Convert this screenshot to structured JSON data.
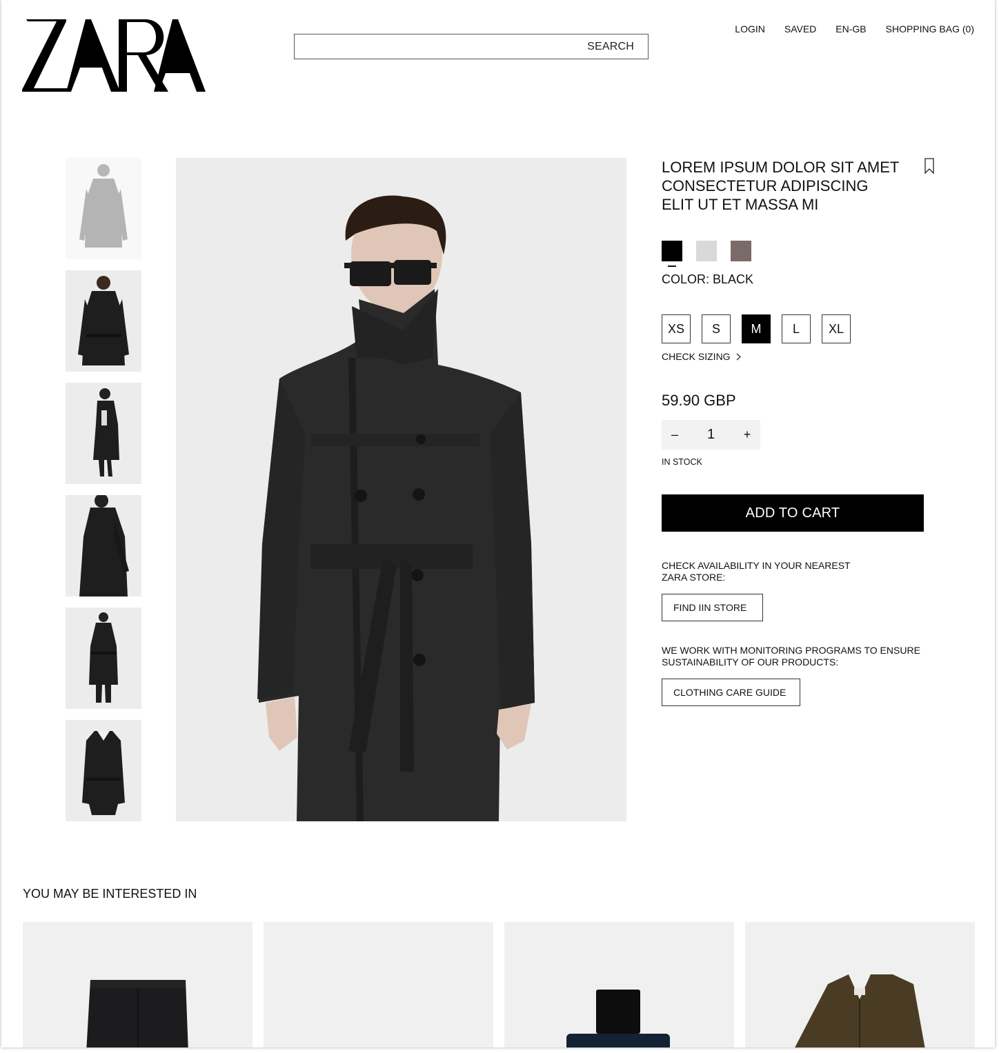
{
  "brand": {
    "logo_text": "ZARA"
  },
  "header": {
    "search_label": "SEARCH",
    "nav": [
      "LOGIN",
      "SAVED",
      "EN-GB",
      "SHOPPING BAG (0)"
    ]
  },
  "product": {
    "title_lines": [
      "LOREM IPSUM DOLOR SIT AMET",
      "CONSECTETUR ADIPISCING",
      "ELIT UT ET MASSA MI"
    ],
    "colors": [
      {
        "name": "black",
        "hex": "#000000",
        "selected": true
      },
      {
        "name": "light-grey",
        "hex": "#d9d9d9",
        "selected": false
      },
      {
        "name": "taupe",
        "hex": "#7a6b69",
        "selected": false
      }
    ],
    "color_label": "COLOR: BLACK",
    "sizes": [
      "XS",
      "S",
      "M",
      "L",
      "XL"
    ],
    "selected_size": "M",
    "check_sizing": "CHECK SIZING",
    "price": "59.90 GBP",
    "quantity": "1",
    "minus": "–",
    "plus": "+",
    "stock": "IN STOCK",
    "add_to_cart": "ADD TO CART",
    "availability_text": "CHECK AVAILABILITY IN YOUR NEAREST ZARA STORE:",
    "find_store": "FIND IIN STORE",
    "sustainability_text": "WE WORK WITH MONITORING PROGRAMS TO ENSURE SUSTAINABILITY OF OUR PRODUCTS:",
    "care_guide": "CLOTHING CARE GUIDE"
  },
  "recommendations": {
    "title": "YOU MAY BE INTERESTED IN"
  },
  "colors": {
    "accent": "#000000",
    "image_bg": "#eeeeee",
    "stepper_bg": "#f2f2f2"
  }
}
